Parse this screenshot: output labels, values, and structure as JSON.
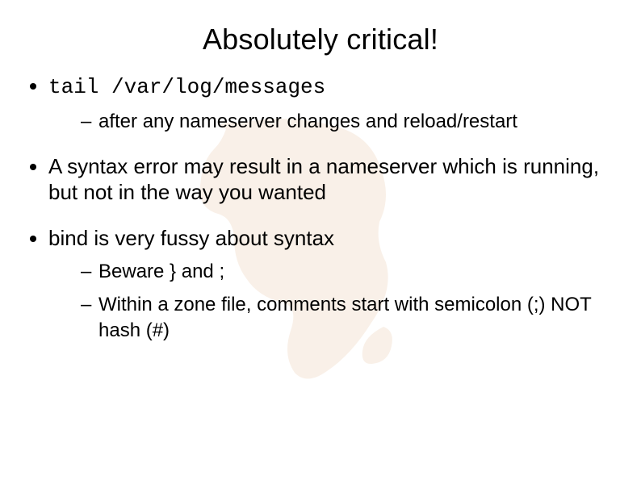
{
  "title": "Absolutely critical!",
  "bullets": {
    "b1": "tail /var/log/messages",
    "b1_sub1": "after any nameserver changes and reload/restart",
    "b2": "A syntax error may result in a nameserver which is running, but not in the way you wanted",
    "b3": "bind is very fussy about syntax",
    "b3_sub1": "Beware } and ;",
    "b3_sub2": "Within a zone file, comments start with semicolon (;) NOT hash (#)"
  }
}
